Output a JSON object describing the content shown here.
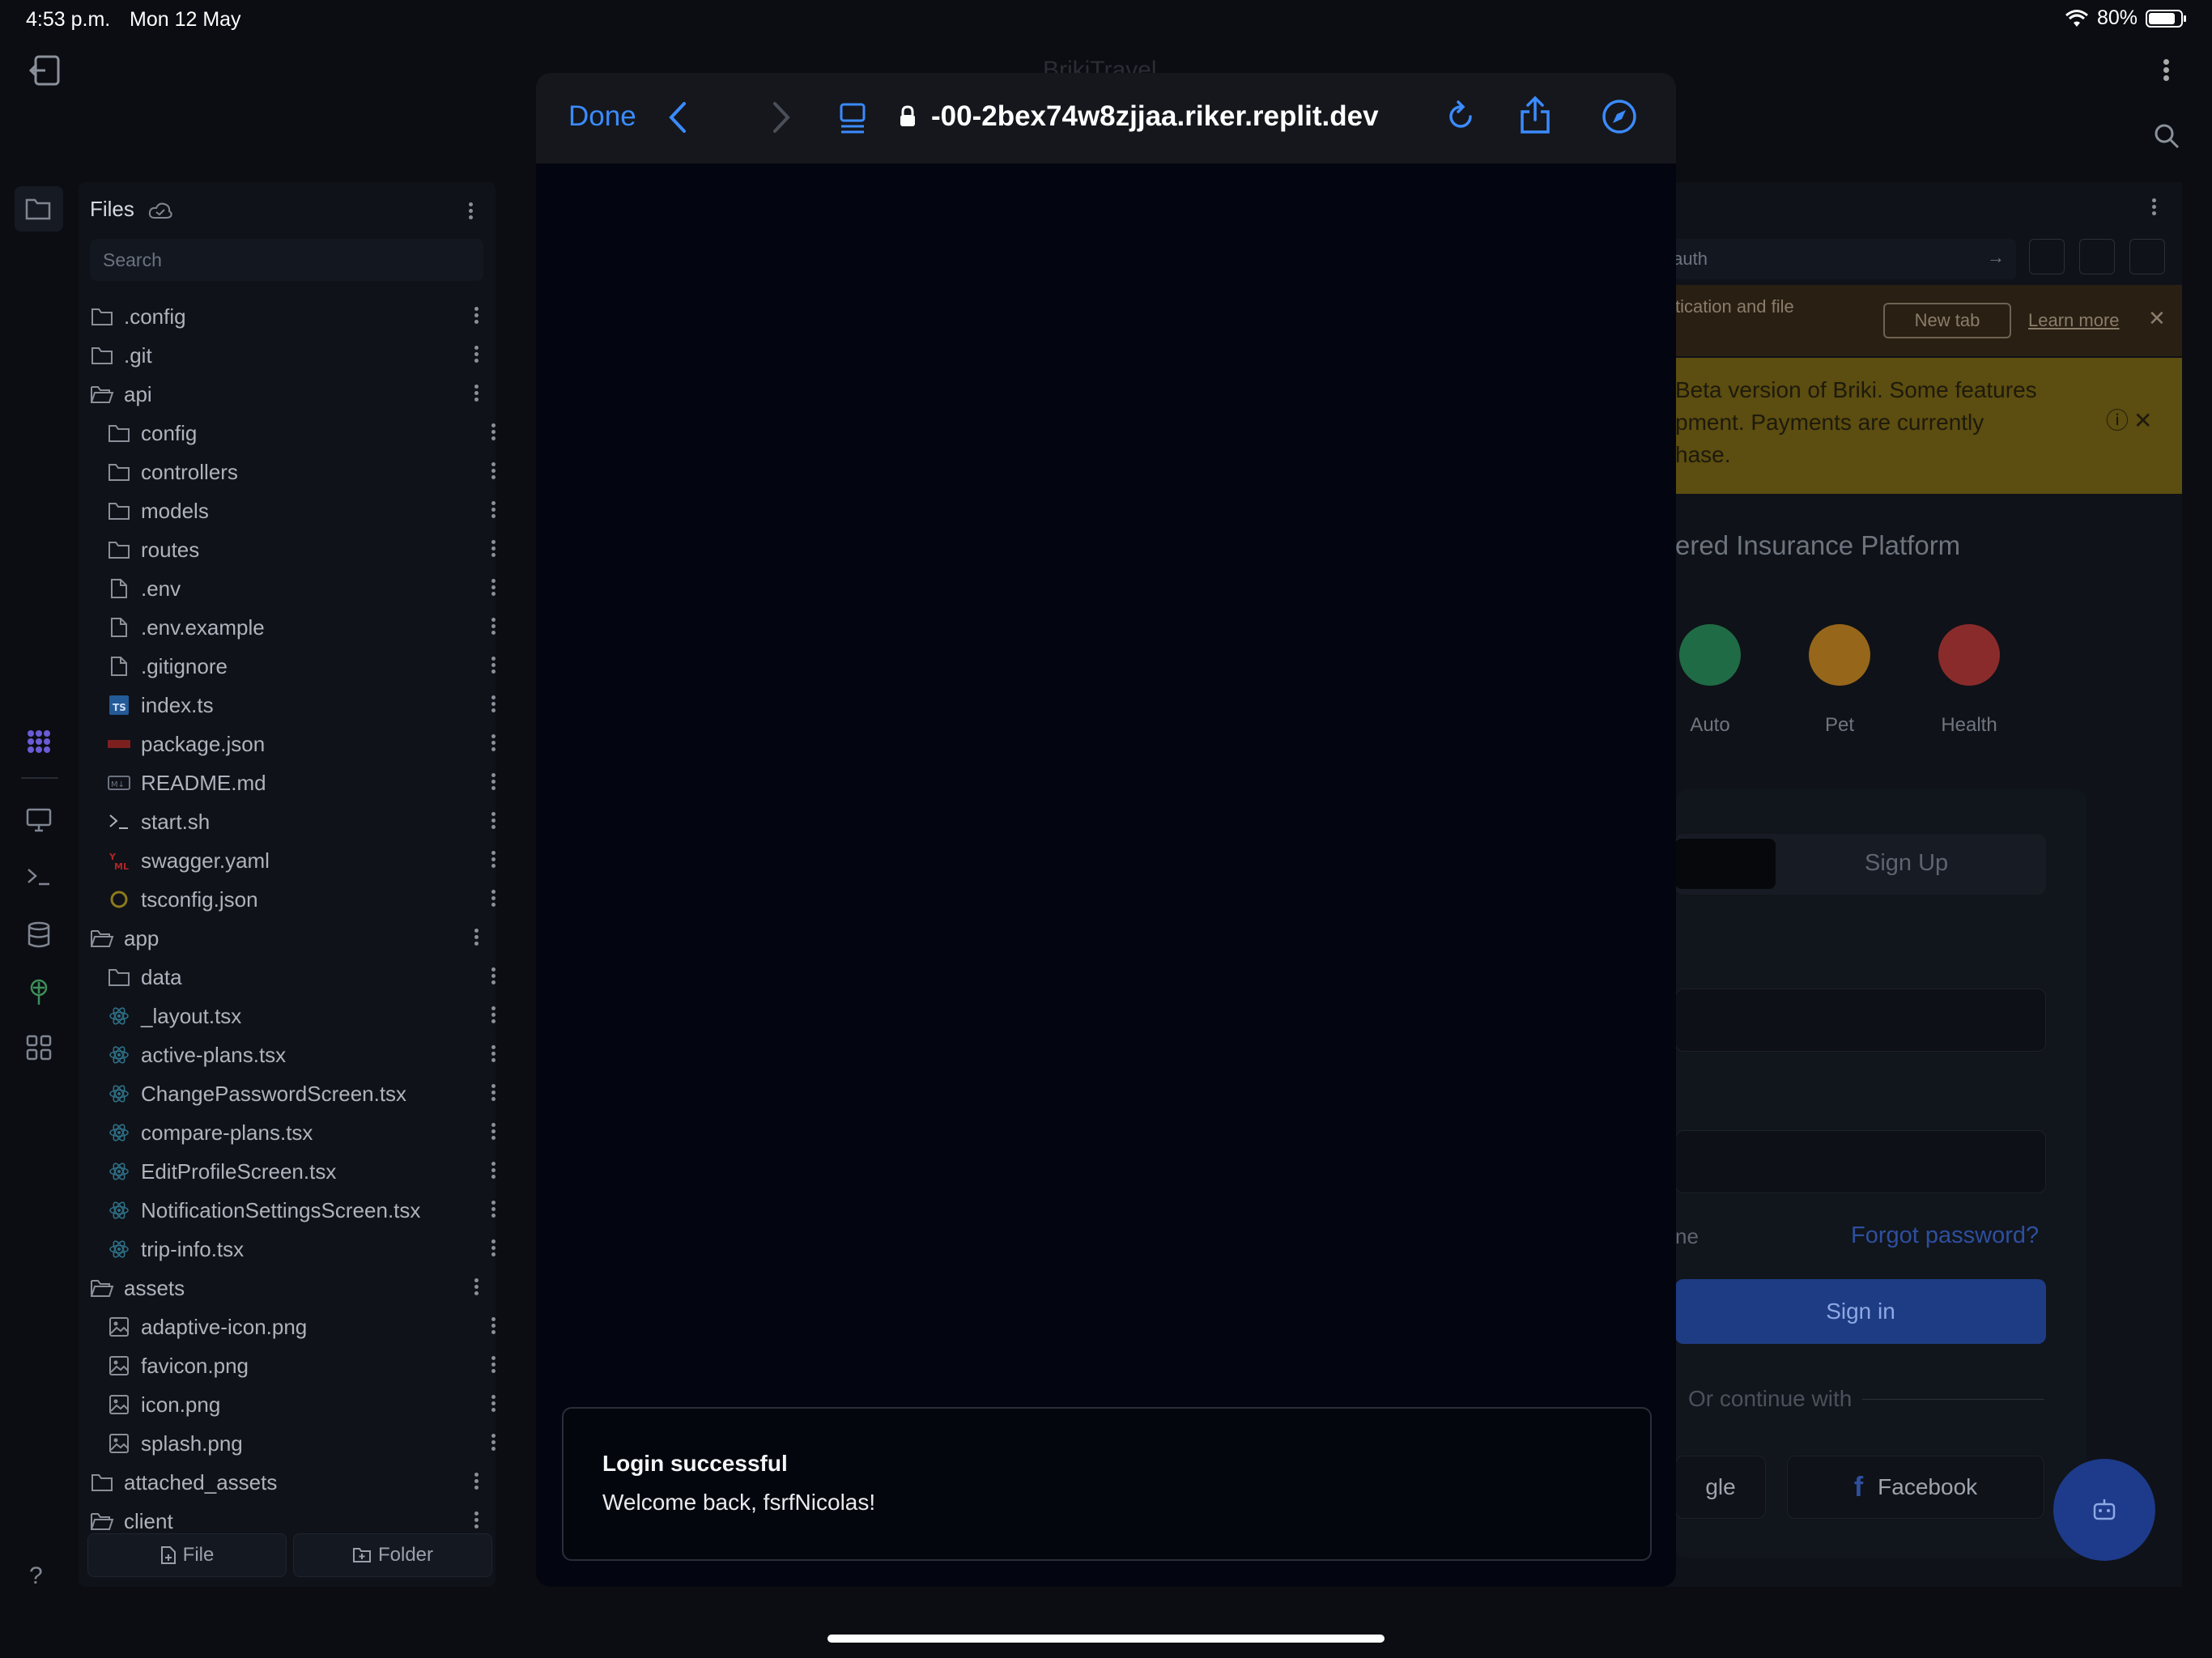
{
  "status_bar": {
    "time": "4:53 p.m.",
    "date": "Mon 12 May",
    "battery": "80%"
  },
  "app": {
    "title": "BrikiTravel"
  },
  "files": {
    "header": "Files",
    "search_placeholder": "Search",
    "tree": [
      {
        "label": ".config",
        "icon": "folder-icon",
        "indent": 0
      },
      {
        "label": ".git",
        "icon": "folder-icon",
        "indent": 0
      },
      {
        "label": "api",
        "icon": "folder-open-icon",
        "indent": 0
      },
      {
        "label": "config",
        "icon": "folder-icon",
        "indent": 1
      },
      {
        "label": "controllers",
        "icon": "folder-icon",
        "indent": 1
      },
      {
        "label": "models",
        "icon": "folder-icon",
        "indent": 1
      },
      {
        "label": "routes",
        "icon": "folder-icon",
        "indent": 1
      },
      {
        "label": ".env",
        "icon": "file-icon",
        "indent": 1
      },
      {
        "label": ".env.example",
        "icon": "file-icon",
        "indent": 1
      },
      {
        "label": ".gitignore",
        "icon": "file-icon",
        "indent": 1
      },
      {
        "label": "index.ts",
        "icon": "typescript-icon",
        "indent": 1
      },
      {
        "label": "package.json",
        "icon": "npm-icon",
        "indent": 1
      },
      {
        "label": "README.md",
        "icon": "markdown-icon",
        "indent": 1
      },
      {
        "label": "start.sh",
        "icon": "terminal-icon",
        "indent": 1
      },
      {
        "label": "swagger.yaml",
        "icon": "yaml-icon",
        "indent": 1
      },
      {
        "label": "tsconfig.json",
        "icon": "tsconfig-icon",
        "indent": 1
      },
      {
        "label": "app",
        "icon": "folder-open-icon",
        "indent": 0
      },
      {
        "label": "data",
        "icon": "folder-icon",
        "indent": 1
      },
      {
        "label": "_layout.tsx",
        "icon": "react-icon",
        "indent": 1
      },
      {
        "label": "active-plans.tsx",
        "icon": "react-icon",
        "indent": 1
      },
      {
        "label": "ChangePasswordScreen.tsx",
        "icon": "react-icon",
        "indent": 1
      },
      {
        "label": "compare-plans.tsx",
        "icon": "react-icon",
        "indent": 1
      },
      {
        "label": "EditProfileScreen.tsx",
        "icon": "react-icon",
        "indent": 1
      },
      {
        "label": "NotificationSettingsScreen.tsx",
        "icon": "react-icon",
        "indent": 1
      },
      {
        "label": "trip-info.tsx",
        "icon": "react-icon",
        "indent": 1
      },
      {
        "label": "assets",
        "icon": "folder-open-icon",
        "indent": 0
      },
      {
        "label": "adaptive-icon.png",
        "icon": "image-icon",
        "indent": 1
      },
      {
        "label": "favicon.png",
        "icon": "image-icon",
        "indent": 1
      },
      {
        "label": "icon.png",
        "icon": "image-icon",
        "indent": 1
      },
      {
        "label": "splash.png",
        "icon": "image-icon",
        "indent": 1
      },
      {
        "label": "attached_assets",
        "icon": "folder-icon",
        "indent": 0
      },
      {
        "label": "client",
        "icon": "folder-open-icon",
        "indent": 0
      }
    ],
    "new_file_label": "File",
    "new_folder_label": "Folder"
  },
  "webview": {
    "url_fragment": "/auth",
    "banner_text": "tication and file",
    "new_tab_label": "New tab",
    "learn_more_label": "Learn more",
    "beta_lines": [
      "Beta version of Briki. Some features",
      "pment. Payments are currently",
      "hase."
    ],
    "platform_title": "ered Insurance Platform",
    "categories": [
      {
        "label": "Auto",
        "color": "#1f7a4d"
      },
      {
        "label": "Pet",
        "color": "#a06a16"
      },
      {
        "label": "Health",
        "color": "#8f2a2a"
      }
    ],
    "signup_tab": "Sign Up",
    "remember_fragment": "ne",
    "forgot_password": "Forgot password?",
    "signin_label": "Sign in",
    "or_continue": "Or continue with",
    "google_fragment": "gle",
    "facebook_label": "Facebook"
  },
  "safari": {
    "done_label": "Done",
    "url": "-00-2bex74w8zjjaa.riker.replit.dev",
    "toast_title": "Login successful",
    "toast_message": "Welcome back, fsrfNicolas!"
  },
  "colors": {
    "accent": "#3b8bff",
    "signin": "#1e3c83"
  }
}
